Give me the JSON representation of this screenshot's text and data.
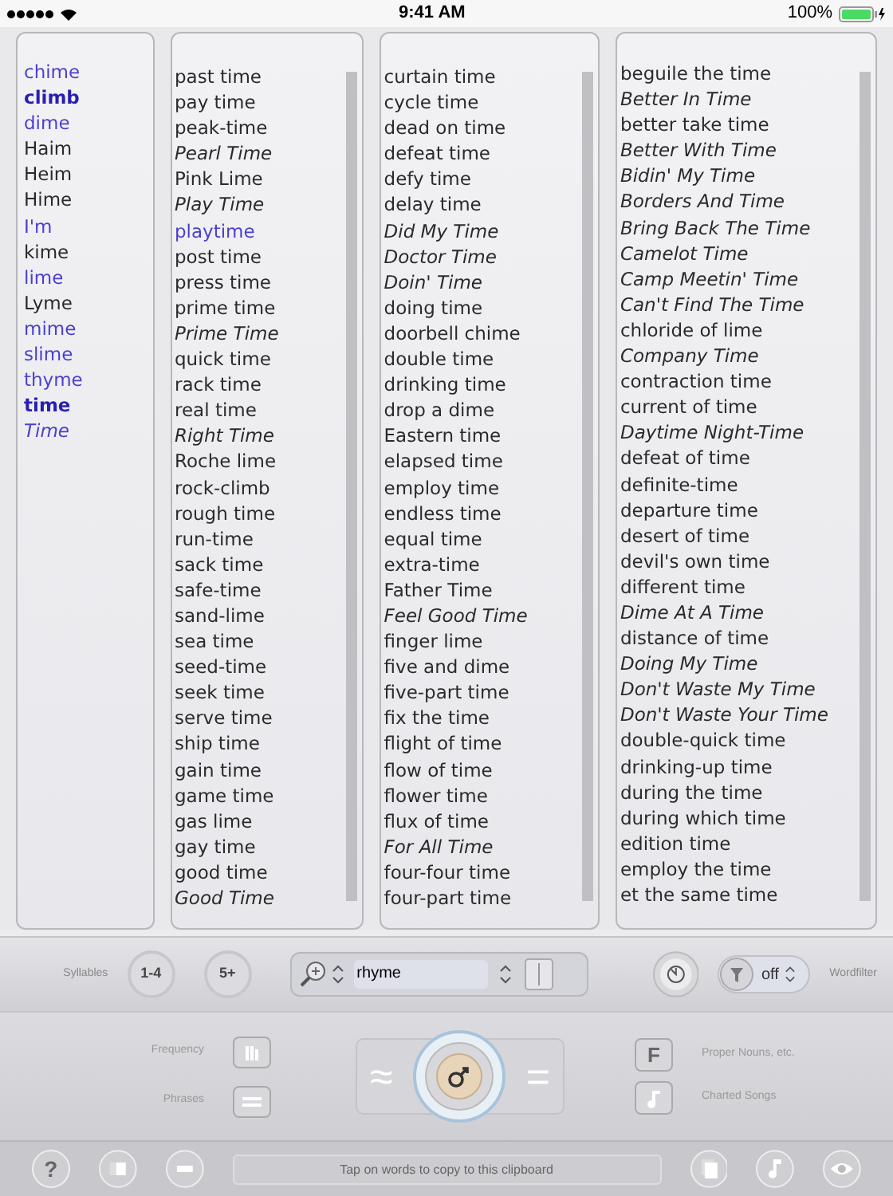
{
  "status_bar": {
    "time": "9:41 AM",
    "battery": "100%"
  },
  "columns": [
    {
      "words": [
        {
          "text": "chime",
          "kind": "common"
        },
        {
          "text": "climb",
          "kind": "common-bold"
        },
        {
          "text": "dime",
          "kind": "common"
        },
        {
          "text": "Haim",
          "kind": "plain"
        },
        {
          "text": "Heim",
          "kind": "plain"
        },
        {
          "text": "Hime",
          "kind": "plain"
        },
        {
          "text": "I'm",
          "kind": "common"
        },
        {
          "text": "kime",
          "kind": "plain"
        },
        {
          "text": "lime",
          "kind": "common"
        },
        {
          "text": "Lyme",
          "kind": "plain"
        },
        {
          "text": "mime",
          "kind": "common"
        },
        {
          "text": "slime",
          "kind": "common"
        },
        {
          "text": "thyme",
          "kind": "common"
        },
        {
          "text": "time",
          "kind": "common-bold"
        },
        {
          "text": "Time",
          "kind": "common-italic"
        }
      ]
    },
    {
      "words": [
        {
          "text": "past time",
          "kind": "plain"
        },
        {
          "text": "pay time",
          "kind": "plain"
        },
        {
          "text": "peak-time",
          "kind": "plain"
        },
        {
          "text": "Pearl Time",
          "kind": "song"
        },
        {
          "text": "Pink Lime",
          "kind": "plain"
        },
        {
          "text": "Play Time",
          "kind": "song"
        },
        {
          "text": "playtime",
          "kind": "common"
        },
        {
          "text": "post time",
          "kind": "plain"
        },
        {
          "text": "press time",
          "kind": "plain"
        },
        {
          "text": "prime time",
          "kind": "plain"
        },
        {
          "text": "Prime Time",
          "kind": "song"
        },
        {
          "text": "quick time",
          "kind": "plain"
        },
        {
          "text": "rack time",
          "kind": "plain"
        },
        {
          "text": "real time",
          "kind": "plain"
        },
        {
          "text": "Right Time",
          "kind": "song"
        },
        {
          "text": "Roche lime",
          "kind": "plain"
        },
        {
          "text": "rock-climb",
          "kind": "plain"
        },
        {
          "text": "rough time",
          "kind": "plain"
        },
        {
          "text": "run-time",
          "kind": "plain"
        },
        {
          "text": "sack time",
          "kind": "plain"
        },
        {
          "text": "safe-time",
          "kind": "plain"
        },
        {
          "text": "sand-lime",
          "kind": "plain"
        },
        {
          "text": "sea time",
          "kind": "plain"
        },
        {
          "text": "seed-time",
          "kind": "plain"
        },
        {
          "text": "seek time",
          "kind": "plain"
        },
        {
          "text": "serve time",
          "kind": "plain"
        },
        {
          "text": "ship time",
          "kind": "plain"
        },
        {
          "text": "gain time",
          "kind": "plain"
        },
        {
          "text": "game time",
          "kind": "plain"
        },
        {
          "text": "gas lime",
          "kind": "plain"
        },
        {
          "text": "gay time",
          "kind": "plain"
        },
        {
          "text": "good time",
          "kind": "plain"
        },
        {
          "text": "Good Time",
          "kind": "song"
        }
      ]
    },
    {
      "words": [
        {
          "text": "curtain time",
          "kind": "plain"
        },
        {
          "text": "cycle time",
          "kind": "plain"
        },
        {
          "text": "dead on time",
          "kind": "plain"
        },
        {
          "text": "defeat time",
          "kind": "plain"
        },
        {
          "text": "defy time",
          "kind": "plain"
        },
        {
          "text": "delay time",
          "kind": "plain"
        },
        {
          "text": "Did My Time",
          "kind": "song"
        },
        {
          "text": "Doctor Time",
          "kind": "song"
        },
        {
          "text": "Doin' Time",
          "kind": "song"
        },
        {
          "text": "doing time",
          "kind": "plain"
        },
        {
          "text": "doorbell chime",
          "kind": "plain"
        },
        {
          "text": "double time",
          "kind": "plain"
        },
        {
          "text": "drinking time",
          "kind": "plain"
        },
        {
          "text": "drop a dime",
          "kind": "plain"
        },
        {
          "text": "Eastern time",
          "kind": "plain"
        },
        {
          "text": "elapsed time",
          "kind": "plain"
        },
        {
          "text": "employ time",
          "kind": "plain"
        },
        {
          "text": "endless time",
          "kind": "plain"
        },
        {
          "text": "equal time",
          "kind": "plain"
        },
        {
          "text": "extra-time",
          "kind": "plain"
        },
        {
          "text": "Father Time",
          "kind": "plain"
        },
        {
          "text": "Feel Good Time",
          "kind": "song"
        },
        {
          "text": "finger lime",
          "kind": "plain"
        },
        {
          "text": "five and dime",
          "kind": "plain"
        },
        {
          "text": "five-part time",
          "kind": "plain"
        },
        {
          "text": "fix the time",
          "kind": "plain"
        },
        {
          "text": "flight of time",
          "kind": "plain"
        },
        {
          "text": "flow of time",
          "kind": "plain"
        },
        {
          "text": "flower time",
          "kind": "plain"
        },
        {
          "text": "flux of time",
          "kind": "plain"
        },
        {
          "text": "For All Time",
          "kind": "song"
        },
        {
          "text": "four-four time",
          "kind": "plain"
        },
        {
          "text": "four-part time",
          "kind": "plain"
        }
      ]
    },
    {
      "words": [
        {
          "text": "beguile the time",
          "kind": "plain"
        },
        {
          "text": "Better In Time",
          "kind": "song"
        },
        {
          "text": "better take time",
          "kind": "plain"
        },
        {
          "text": "Better With Time",
          "kind": "song"
        },
        {
          "text": "Bidin' My Time",
          "kind": "song"
        },
        {
          "text": "Borders And Time",
          "kind": "song"
        },
        {
          "text": "Bring Back The Time",
          "kind": "song"
        },
        {
          "text": "Camelot Time",
          "kind": "song"
        },
        {
          "text": "Camp Meetin' Time",
          "kind": "song"
        },
        {
          "text": "Can't Find The Time",
          "kind": "song"
        },
        {
          "text": "chloride of lime",
          "kind": "plain"
        },
        {
          "text": "Company Time",
          "kind": "song"
        },
        {
          "text": "contraction time",
          "kind": "plain"
        },
        {
          "text": "current of time",
          "kind": "plain"
        },
        {
          "text": "Daytime Night-Time",
          "kind": "song"
        },
        {
          "text": "defeat of time",
          "kind": "plain"
        },
        {
          "text": "definite-time",
          "kind": "plain"
        },
        {
          "text": "departure time",
          "kind": "plain"
        },
        {
          "text": "desert of time",
          "kind": "plain"
        },
        {
          "text": "devil's own time",
          "kind": "plain"
        },
        {
          "text": "different time",
          "kind": "plain"
        },
        {
          "text": "Dime At A Time",
          "kind": "song"
        },
        {
          "text": "distance of time",
          "kind": "plain"
        },
        {
          "text": "Doing My Time",
          "kind": "song"
        },
        {
          "text": "Don't Waste My Time",
          "kind": "song"
        },
        {
          "text": "Don't Waste Your Time",
          "kind": "song"
        },
        {
          "text": "double-quick time",
          "kind": "plain"
        },
        {
          "text": "drinking-up time",
          "kind": "plain"
        },
        {
          "text": "during the time",
          "kind": "plain"
        },
        {
          "text": "during which time",
          "kind": "plain"
        },
        {
          "text": "edition time",
          "kind": "plain"
        },
        {
          "text": "employ the time",
          "kind": "plain"
        },
        {
          "text": "et the same time",
          "kind": "plain"
        }
      ]
    }
  ],
  "controls": {
    "syllables_label": "Syllables",
    "syllable_buttons": [
      "1-4",
      "5+"
    ],
    "search_value": "rhyme",
    "filter_value": "off",
    "wordfilter_label": "Wordfilter"
  },
  "options": {
    "frequency_label": "Frequency",
    "phrases_label": "Phrases",
    "approx_symbol": "≈",
    "equals_symbol": "=",
    "proper_button": "F",
    "proper_label": "Proper Nouns, etc.",
    "charted_label": "Charted Songs"
  },
  "bottom_bar": {
    "help_button": "?",
    "clipboard_placeholder": "Tap on words to copy to this clipboard"
  }
}
